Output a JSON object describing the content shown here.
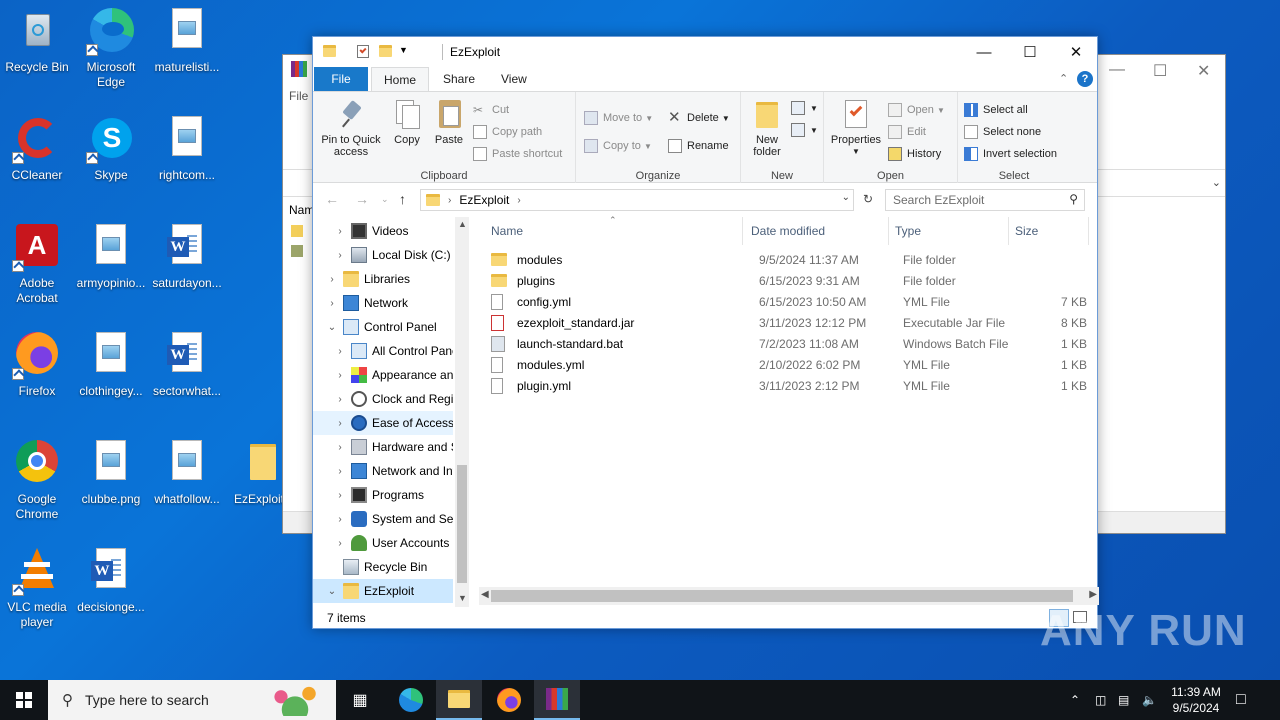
{
  "desktop": {
    "icons": [
      {
        "label": "Recycle Bin"
      },
      {
        "label": "Microsoft Edge"
      },
      {
        "label": "maturelisti..."
      },
      {
        "label": "CCleaner"
      },
      {
        "label": "Skype"
      },
      {
        "label": "rightcom..."
      },
      {
        "label": "Adobe Acrobat"
      },
      {
        "label": "armyopinio..."
      },
      {
        "label": "saturdayon..."
      },
      {
        "label": "Firefox"
      },
      {
        "label": "clothingey..."
      },
      {
        "label": "sectorwhat..."
      },
      {
        "label": "Google Chrome"
      },
      {
        "label": "clubbe.png"
      },
      {
        "label": "whatfollow..."
      },
      {
        "label": "EzExploit"
      },
      {
        "label": "VLC media player"
      },
      {
        "label": "decisionge..."
      }
    ]
  },
  "winrar_bg": {
    "menu_text": "File"
  },
  "explorer": {
    "title": "EzExploit",
    "tabs": {
      "file": "File",
      "home": "Home",
      "share": "Share",
      "view": "View"
    },
    "ribbon": {
      "clipboard": {
        "group": "Clipboard",
        "pin": "Pin to Quick access",
        "copy": "Copy",
        "paste": "Paste",
        "cut": "Cut",
        "copy_path": "Copy path",
        "paste_shortcut": "Paste shortcut"
      },
      "organize": {
        "group": "Organize",
        "move_to": "Move to",
        "copy_to": "Copy to",
        "delete": "Delete",
        "rename": "Rename"
      },
      "new": {
        "group": "New",
        "new_folder": "New folder"
      },
      "open": {
        "group": "Open",
        "properties": "Properties",
        "open": "Open",
        "edit": "Edit",
        "history": "History"
      },
      "select": {
        "group": "Select",
        "select_all": "Select all",
        "select_none": "Select none",
        "invert": "Invert selection"
      }
    },
    "address": {
      "path": "EzExploit"
    },
    "search": {
      "placeholder": "Search EzExploit"
    },
    "nav": [
      {
        "label": "Videos"
      },
      {
        "label": "Local Disk (C:)"
      },
      {
        "label": "Libraries"
      },
      {
        "label": "Network"
      },
      {
        "label": "Control Panel"
      },
      {
        "label": "All Control Panel Items"
      },
      {
        "label": "Appearance and Personalization"
      },
      {
        "label": "Clock and Region"
      },
      {
        "label": "Ease of Access"
      },
      {
        "label": "Hardware and Sound"
      },
      {
        "label": "Network and Internet"
      },
      {
        "label": "Programs"
      },
      {
        "label": "System and Security"
      },
      {
        "label": "User Accounts"
      },
      {
        "label": "Recycle Bin"
      },
      {
        "label": "EzExploit"
      }
    ],
    "columns": {
      "name": "Name",
      "date": "Date modified",
      "type": "Type",
      "size": "Size"
    },
    "files": [
      {
        "name": "modules",
        "date": "9/5/2024 11:37 AM",
        "type": "File folder",
        "size": "",
        "icon": "folder-icon"
      },
      {
        "name": "plugins",
        "date": "6/15/2023 9:31 AM",
        "type": "File folder",
        "size": "",
        "icon": "folder-icon"
      },
      {
        "name": "config.yml",
        "date": "6/15/2023 10:50 AM",
        "type": "YML File",
        "size": "7 KB",
        "icon": "file-icon"
      },
      {
        "name": "ezexploit_standard.jar",
        "date": "3/11/2023 12:12 PM",
        "type": "Executable Jar File",
        "size": "8 KB",
        "icon": "jar-icon"
      },
      {
        "name": "launch-standard.bat",
        "date": "7/2/2023 11:08 AM",
        "type": "Windows Batch File",
        "size": "1 KB",
        "icon": "bat-icon"
      },
      {
        "name": "modules.yml",
        "date": "2/10/2022 6:02 PM",
        "type": "YML File",
        "size": "1 KB",
        "icon": "file-icon"
      },
      {
        "name": "plugin.yml",
        "date": "3/11/2023 2:12 PM",
        "type": "YML File",
        "size": "1 KB",
        "icon": "file-icon"
      }
    ],
    "status": "7 items"
  },
  "taskbar": {
    "search_placeholder": "Type here to search",
    "time": "11:39 AM",
    "date": "9/5/2024"
  },
  "watermark": "ANY RUN"
}
